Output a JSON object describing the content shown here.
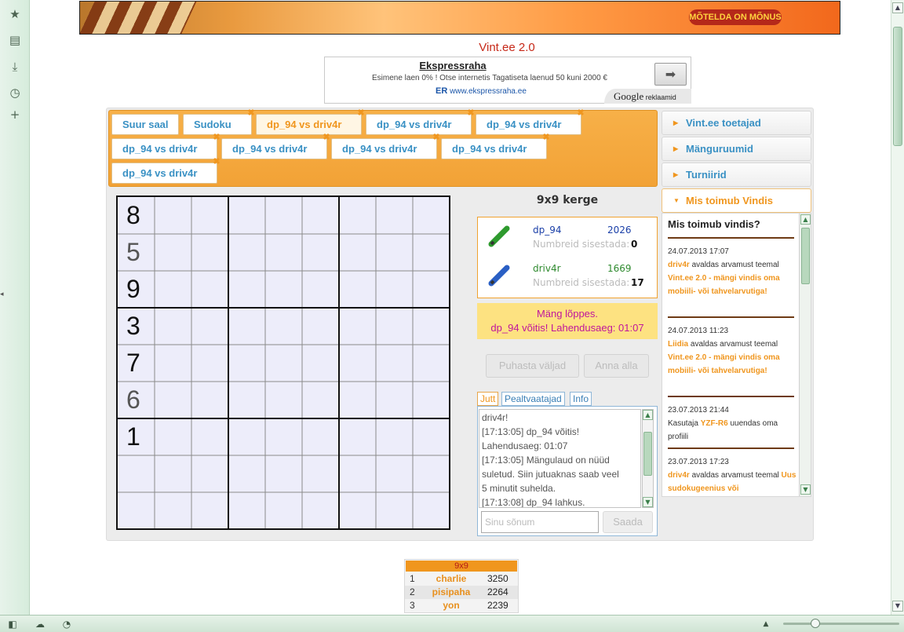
{
  "browser": {
    "sidebar_icons": [
      "star-icon",
      "note-icon",
      "download-icon",
      "history-icon",
      "plus-icon"
    ],
    "status_icons": [
      "panel-icon",
      "cloud-icon",
      "speed-icon"
    ]
  },
  "banner": {
    "slogan": "MÕTELDA ON MÕNUS"
  },
  "site_title": "Vint.ee 2.0",
  "ad": {
    "title": "Ekspressraha",
    "description": "Esimene laen 0% ! Otse internetis Tagatiseta laenud 50 kuni 2000 €",
    "logo": "ER",
    "url": "www.ekspressraha.ee",
    "google_brand": "Google",
    "google_label": "reklaamid"
  },
  "tabs": [
    {
      "label": "Suur saal",
      "closable": false,
      "active": false
    },
    {
      "label": "Sudoku",
      "closable": true,
      "active": false
    },
    {
      "label": "dp_94 vs driv4r",
      "closable": true,
      "active": true
    },
    {
      "label": "dp_94 vs driv4r",
      "closable": true,
      "active": false
    },
    {
      "label": "dp_94 vs driv4r",
      "closable": true,
      "active": false
    },
    {
      "label": "dp_94 vs driv4r",
      "closable": true,
      "active": false
    },
    {
      "label": "dp_94 vs driv4r",
      "closable": true,
      "active": false
    },
    {
      "label": "dp_94 vs driv4r",
      "closable": true,
      "active": false
    },
    {
      "label": "dp_94 vs driv4r",
      "closable": true,
      "active": false
    },
    {
      "label": "dp_94 vs driv4r",
      "closable": true,
      "active": false
    }
  ],
  "board": {
    "cells": [
      {
        "row": 0,
        "col": 0,
        "value": "8",
        "type": "given"
      },
      {
        "row": 1,
        "col": 0,
        "value": "5",
        "type": "user"
      },
      {
        "row": 2,
        "col": 0,
        "value": "9",
        "type": "given"
      },
      {
        "row": 3,
        "col": 0,
        "value": "3",
        "type": "given"
      },
      {
        "row": 4,
        "col": 0,
        "value": "7",
        "type": "given"
      },
      {
        "row": 5,
        "col": 0,
        "value": "6",
        "type": "user"
      },
      {
        "row": 6,
        "col": 0,
        "value": "1",
        "type": "given"
      }
    ]
  },
  "game": {
    "difficulty": "9x9 kerge",
    "players": [
      {
        "name": "dp_94",
        "rating": "2026",
        "label": "Numbreid sisestada:",
        "count": "0",
        "name_color": "#1a3fa8",
        "rating_color": "#1a3fa8",
        "pencil_color": "#2e9a2e"
      },
      {
        "name": "driv4r",
        "rating": "1669",
        "label": "Numbreid sisestada:",
        "count": "17",
        "name_color": "#2e8a2e",
        "rating_color": "#2e8a2e",
        "pencil_color": "#2a5fc4"
      }
    ],
    "result_line1": "Mäng lõppes.",
    "result_line2": "dp_94 võitis! Lahendusaeg: 01:07",
    "clear_button": "Puhasta väljad",
    "resign_button": "Anna alla"
  },
  "chat": {
    "tabs": [
      "Jutt",
      "Pealtvaatajad",
      "Info"
    ],
    "lines": [
      "driv4r!",
      "[17:13:05] dp_94 võitis!",
      "Lahendusaeg: 01:07",
      "[17:13:05] Mängulaud on nüüd",
      "suletud. Siin jutuaknas saab veel",
      "5 minutit suhelda.",
      "[17:13:08] dp_94 lahkus."
    ],
    "input_placeholder": "Sinu sõnum",
    "send_button": "Saada"
  },
  "sidebar": {
    "items": [
      {
        "label": "Vint.ee toetajad",
        "open": false
      },
      {
        "label": "Mänguruumid",
        "open": false
      },
      {
        "label": "Turniirid",
        "open": false
      },
      {
        "label": "Mis toimub Vindis",
        "open": true
      }
    ],
    "news_title": "Mis toimub vindis?",
    "news": [
      {
        "time": "24.07.2013 17:07",
        "user": "driv4r",
        "action": "avaldas arvamust teemal",
        "topic": "Vint.ee 2.0 - mängi vindis oma mobiili- või tahvelarvutiga!"
      },
      {
        "time": "24.07.2013 11:23",
        "user": "Liidia",
        "action": "avaldas arvamust teemal",
        "topic": "Vint.ee 2.0 - mängi vindis oma mobiili- või tahvelarvutiga!"
      },
      {
        "time": "23.07.2013 21:44",
        "prefix": "Kasutaja",
        "user": "YZF-R6",
        "action": "uuendas oma profiili",
        "topic": ""
      },
      {
        "time": "23.07.2013 17:23",
        "user": "driv4r",
        "action": "avaldas arvamust teemal",
        "topic": "Uus sudokugeenius või"
      }
    ]
  },
  "leaderboard": {
    "title": "9x9",
    "rows": [
      {
        "rank": "1",
        "name": "charlie",
        "score": "3250"
      },
      {
        "rank": "2",
        "name": "pisipaha",
        "score": "2264"
      },
      {
        "rank": "3",
        "name": "yon",
        "score": "2239"
      }
    ]
  }
}
